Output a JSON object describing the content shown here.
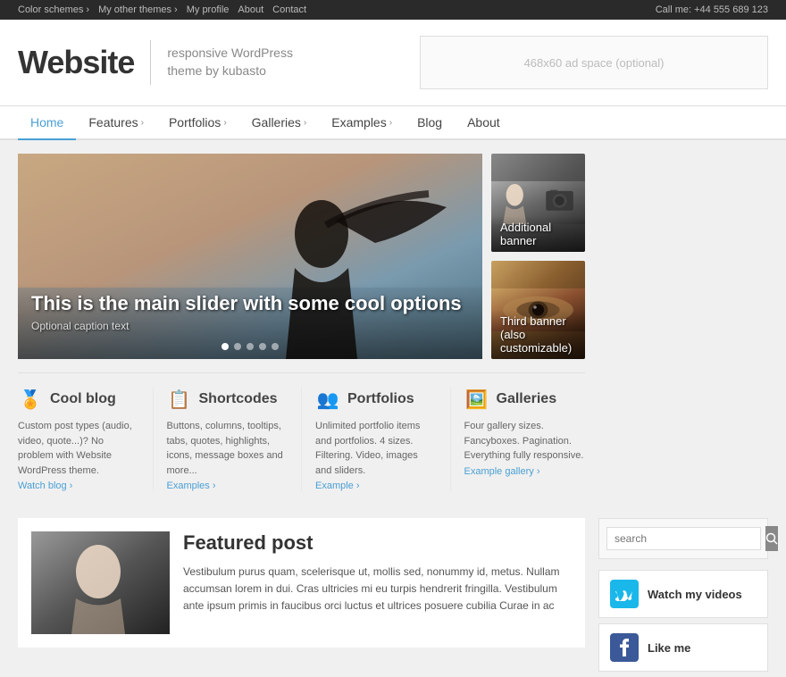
{
  "topbar": {
    "links": [
      {
        "label": "Color schemes ›",
        "name": "color-schemes"
      },
      {
        "label": "My other themes ›",
        "name": "other-themes"
      },
      {
        "label": "My profile",
        "name": "my-profile"
      },
      {
        "label": "About",
        "name": "about-topbar"
      },
      {
        "label": "Contact",
        "name": "contact"
      }
    ],
    "phone": "Call me: +44 555 689 123"
  },
  "header": {
    "title": "Website",
    "tagline_line1": "responsive WordPress",
    "tagline_line2": "theme by kubasto",
    "ad_text": "468x60 ad space (optional)"
  },
  "nav": {
    "items": [
      {
        "label": "Home",
        "name": "home",
        "active": true,
        "has_arrow": false
      },
      {
        "label": "Features",
        "name": "features",
        "active": false,
        "has_arrow": true
      },
      {
        "label": "Portfolios",
        "name": "portfolios",
        "active": false,
        "has_arrow": true
      },
      {
        "label": "Galleries",
        "name": "galleries",
        "active": false,
        "has_arrow": true
      },
      {
        "label": "Examples",
        "name": "examples",
        "active": false,
        "has_arrow": true
      },
      {
        "label": "Blog",
        "name": "blog",
        "active": false,
        "has_arrow": false
      },
      {
        "label": "About",
        "name": "about",
        "active": false,
        "has_arrow": false
      }
    ]
  },
  "slider": {
    "title": "This is the main slider with some cool options",
    "caption": "Optional caption text",
    "dots_count": 5,
    "active_dot": 0
  },
  "banners": [
    {
      "label": "Additional banner",
      "name": "banner-1"
    },
    {
      "label": "Third banner (also customizable)",
      "name": "banner-2"
    }
  ],
  "features": [
    {
      "name": "cool-blog",
      "icon": "🏅",
      "title": "Cool blog",
      "text": "Custom post types (audio, video, quote...)? No problem with Website WordPress theme.",
      "link_text": "Watch blog ›",
      "link_name": "watch-blog-link"
    },
    {
      "name": "shortcodes",
      "icon": "📋",
      "title": "Shortcodes",
      "text": "Buttons, columns, tooltips, tabs, quotes, highlights, icons, message boxes and more...",
      "link_text": "Examples ›",
      "link_name": "shortcodes-examples-link"
    },
    {
      "name": "portfolios",
      "icon": "👥",
      "title": "Portfolios",
      "text": "Unlimited portfolio items and portfolios. 4 sizes. Filtering. Video, images and sliders.",
      "link_text": "Example ›",
      "link_name": "portfolios-example-link"
    },
    {
      "name": "galleries",
      "icon": "🖼️",
      "title": "Galleries",
      "text": "Four gallery sizes. Fancyboxes. Pagination. Everything fully responsive.",
      "link_text": "Example gallery ›",
      "link_name": "galleries-example-link"
    }
  ],
  "featured_post": {
    "title": "Featured post",
    "text": "Vestibulum purus quam, scelerisque ut, mollis sed, nonummy id, metus. Nullam accumsan lorem in dui. Cras ultricies mi eu turpis hendrerit fringilla. Vestibulum ante ipsum primis in faucibus orci luctus et ultrices posuere cubilia Curae in ac"
  },
  "sidebar": {
    "search_placeholder": "search",
    "social": [
      {
        "name": "vimeo",
        "label": "Watch my videos",
        "icon_type": "vimeo"
      },
      {
        "name": "facebook",
        "label": "Like me",
        "icon_type": "facebook"
      }
    ]
  }
}
